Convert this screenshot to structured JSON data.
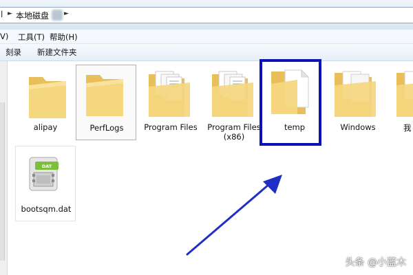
{
  "address": {
    "left_glyph": "l",
    "path_label": "本地磁盘"
  },
  "menu": {
    "view_fragment": "V)",
    "tools": "工具(T)",
    "help": "帮助(H)"
  },
  "toolbar": {
    "burn": "刻录",
    "new_folder": "新建文件夹"
  },
  "items": [
    {
      "label": "alipay"
    },
    {
      "label": "PerfLogs"
    },
    {
      "label": "Program Files"
    },
    {
      "label": "Program Files\n(x86)"
    },
    {
      "label": "temp"
    },
    {
      "label": "Windows"
    },
    {
      "label": "我"
    },
    {
      "label": "bootsqm.dat",
      "badge": "DAT"
    }
  ],
  "watermark": "头条 @小蓝木",
  "colors": {
    "highlight": "#0a12b8",
    "arrow": "#1f2fc4",
    "folder": "#f2d27a"
  }
}
